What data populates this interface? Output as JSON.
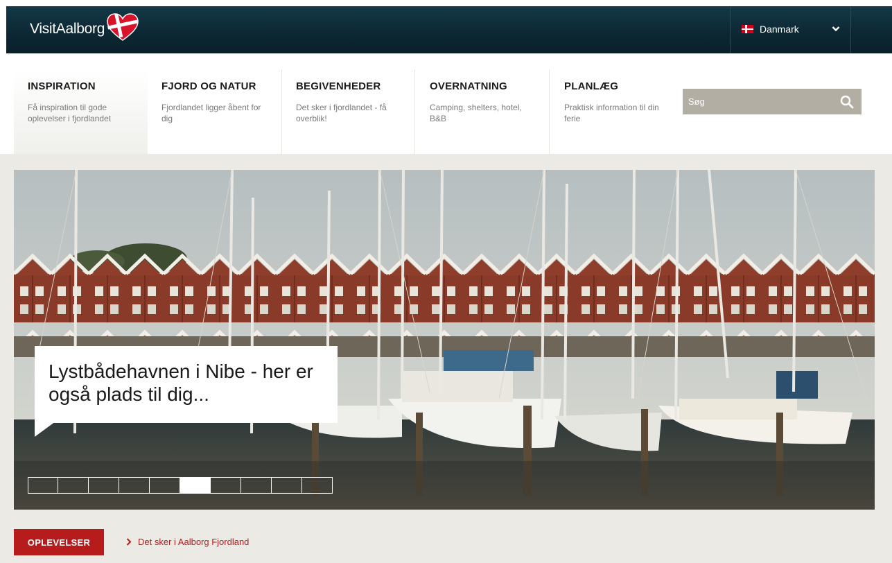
{
  "header": {
    "logo_text": "VisitAalborg",
    "language_label": "Danmark",
    "flag_icon": "danish-flag-icon"
  },
  "nav": {
    "items": [
      {
        "title": "INSPIRATION",
        "sub": "Få inspiration til gode oplevelser i fjordlandet",
        "active": true
      },
      {
        "title": "FJORD OG NATUR",
        "sub": "Fjordlandet ligger åbent for dig"
      },
      {
        "title": "BEGIVENHEDER",
        "sub": "Det sker i fjordlandet - få overblik!"
      },
      {
        "title": "OVERNATNING",
        "sub": "Camping, shelters, hotel, B&B"
      },
      {
        "title": "PLANLÆG",
        "sub": "Praktisk information til din ferie"
      }
    ]
  },
  "search": {
    "placeholder": "Søg"
  },
  "hero": {
    "caption": "Lystbådehavnen i Nibe - her er også plads til dig...",
    "slide_count": 10,
    "active_slide": 6
  },
  "bottom": {
    "tag_label": "OPLEVELSER",
    "link_label": "Det sker i Aalborg Fjordland"
  },
  "colors": {
    "topbar": "#0c2733",
    "accent_red": "#b71c1c",
    "search_bg": "#b3aea4",
    "page_bg": "#eceae5"
  }
}
